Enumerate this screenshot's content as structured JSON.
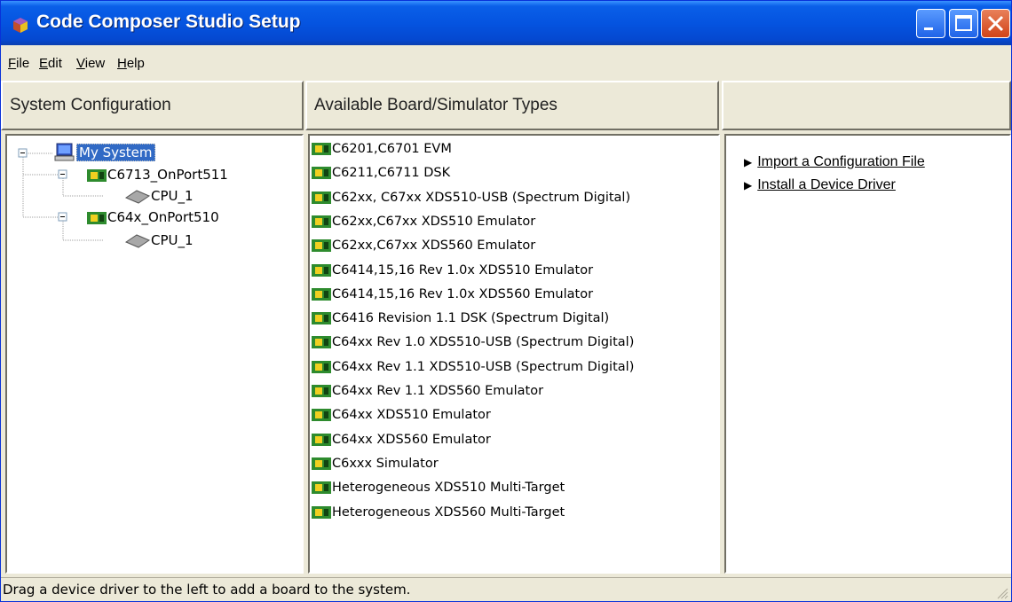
{
  "window": {
    "title": "Code Composer Studio Setup"
  },
  "menu": [
    {
      "label": "File",
      "mnemonic": "F",
      "rest": "ile"
    },
    {
      "label": "Edit",
      "mnemonic": "E",
      "rest": "dit"
    },
    {
      "label": "View",
      "mnemonic": "V",
      "rest": "iew"
    },
    {
      "label": "Help",
      "mnemonic": "H",
      "rest": "elp"
    }
  ],
  "panes": {
    "system_header": "System Configuration",
    "boards_header": "Available Board/Simulator Types",
    "actions_header": ""
  },
  "tree": {
    "root": "My System",
    "board1": "C6713_OnPort511",
    "board1_cpu": "CPU_1",
    "board2": "C64x_OnPort510",
    "board2_cpu": "CPU_1"
  },
  "boards": [
    "C6201,C6701 EVM",
    "C6211,C6711 DSK",
    "C62xx, C67xx XDS510-USB (Spectrum Digital)",
    "C62xx,C67xx XDS510 Emulator",
    "C62xx,C67xx XDS560 Emulator",
    "C6414,15,16 Rev 1.0x XDS510 Emulator",
    "C6414,15,16 Rev 1.0x XDS560 Emulator",
    "C6416 Revision 1.1 DSK  (Spectrum Digital)",
    "C64xx Rev 1.0 XDS510-USB (Spectrum Digital)",
    "C64xx Rev 1.1 XDS510-USB (Spectrum Digital)",
    "C64xx Rev 1.1 XDS560 Emulator",
    "C64xx XDS510 Emulator",
    "C64xx XDS560 Emulator",
    "C6xxx Simulator",
    "Heterogeneous XDS510 Multi-Target",
    "Heterogeneous XDS560 Multi-Target"
  ],
  "actions": {
    "import": "Import a Configuration File",
    "install": "Install a Device Driver"
  },
  "status": "Drag a device driver to the left to add a board to the system.",
  "colors": {
    "title_blue": "#0554e0",
    "selection": "#316ac5",
    "chrome": "#ece9d8"
  }
}
